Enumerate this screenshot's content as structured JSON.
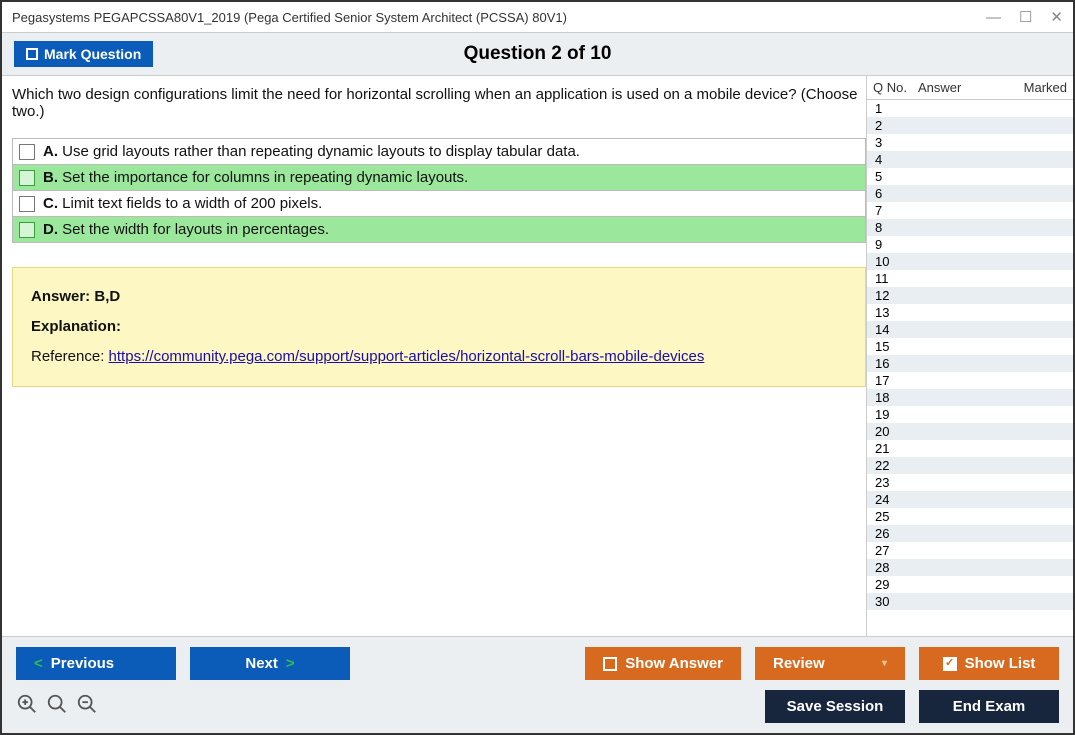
{
  "window_title": "Pegasystems PEGAPCSSA80V1_2019 (Pega Certified Senior System Architect (PCSSA) 80V1)",
  "header": {
    "mark_label": "Mark Question",
    "question_title": "Question 2 of 10"
  },
  "question": {
    "text": "Which two design configurations limit the need for horizontal scrolling when an application is used on a mobile device? (Choose two.)",
    "options": [
      {
        "letter": "A.",
        "text": "Use grid layouts rather than repeating dynamic layouts to display tabular data.",
        "correct": false
      },
      {
        "letter": "B.",
        "text": "Set the importance for columns in repeating dynamic layouts.",
        "correct": true
      },
      {
        "letter": "C.",
        "text": "Limit text fields to a width of 200 pixels.",
        "correct": false
      },
      {
        "letter": "D.",
        "text": "Set the width for layouts in percentages.",
        "correct": true
      }
    ]
  },
  "answer_box": {
    "answer_label": "Answer:",
    "answer_value": "B,D",
    "explanation_label": "Explanation:",
    "reference_label": "Reference:",
    "reference_link": "https://community.pega.com/support/support-articles/horizontal-scroll-bars-mobile-devices"
  },
  "side": {
    "col_qno": "Q No.",
    "col_answer": "Answer",
    "col_marked": "Marked",
    "rows": [
      "1",
      "2",
      "3",
      "4",
      "5",
      "6",
      "7",
      "8",
      "9",
      "10",
      "11",
      "12",
      "13",
      "14",
      "15",
      "16",
      "17",
      "18",
      "19",
      "20",
      "21",
      "22",
      "23",
      "24",
      "25",
      "26",
      "27",
      "28",
      "29",
      "30"
    ]
  },
  "footer": {
    "previous": "Previous",
    "next": "Next",
    "show_answer": "Show Answer",
    "review": "Review",
    "show_list": "Show List",
    "save_session": "Save Session",
    "end_exam": "End Exam"
  }
}
